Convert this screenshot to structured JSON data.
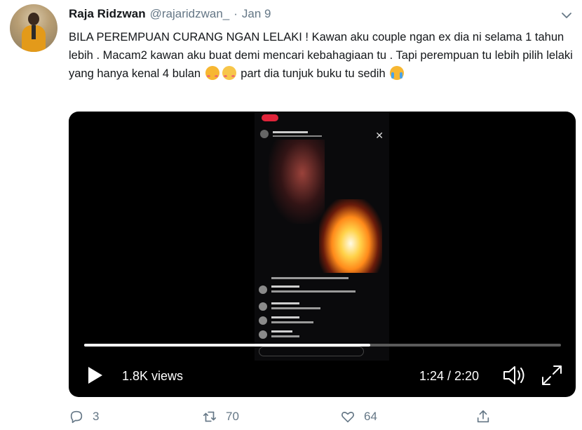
{
  "tweet": {
    "author_name": "Raja Ridzwan",
    "author_handle": "@rajaridzwan_",
    "separator": "·",
    "date": "Jan 9",
    "text_part1": "BILA PEREMPUAN CURANG NGAN LELAKI ! Kawan aku couple ngan ex dia ni selama 1 tahun lebih . Macam2 kawan aku buat demi mencari kebahagiaan tu . Tapi perempuan tu lebih pilih lelaki yang hanya kenal 4 bulan",
    "text_part2": "part dia tunjuk buku tu sedih",
    "emojis": [
      "smiling-face-with-hearts",
      "relieved-face",
      "loudly-crying-face"
    ]
  },
  "video": {
    "views": "1.8K views",
    "time": "1:24 / 2:20",
    "progress": 0.6,
    "icons": [
      "play-icon",
      "volume-icon",
      "fullscreen-icon"
    ]
  },
  "actions": {
    "replies": "3",
    "retweets": "70",
    "likes": "64"
  },
  "colors": {
    "text": "#14171a",
    "secondary": "#657786",
    "video_bg": "#000000"
  }
}
